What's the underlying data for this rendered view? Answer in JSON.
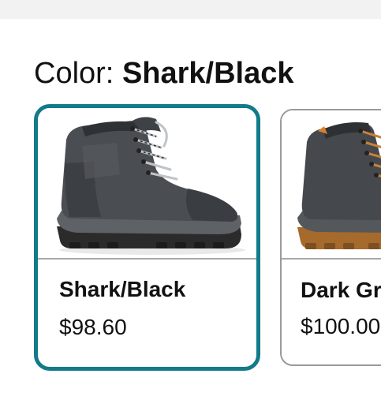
{
  "color_selector": {
    "label": "Color:",
    "selected_value": "Shark/Black"
  },
  "swatches": [
    {
      "name": "Shark/Black",
      "price": "$98.60",
      "selected": true,
      "image_icon": "hiking-boot-gray-black"
    },
    {
      "name": "Dark Gr",
      "price": "$100.00",
      "selected": false,
      "image_icon": "hiking-boot-dark-gray-orange"
    }
  ],
  "colors": {
    "selected_border": "#127a89",
    "unselected_border": "#9a9a9a",
    "divider": "#a9a9a9",
    "top_strip": "#f2f2f2"
  }
}
